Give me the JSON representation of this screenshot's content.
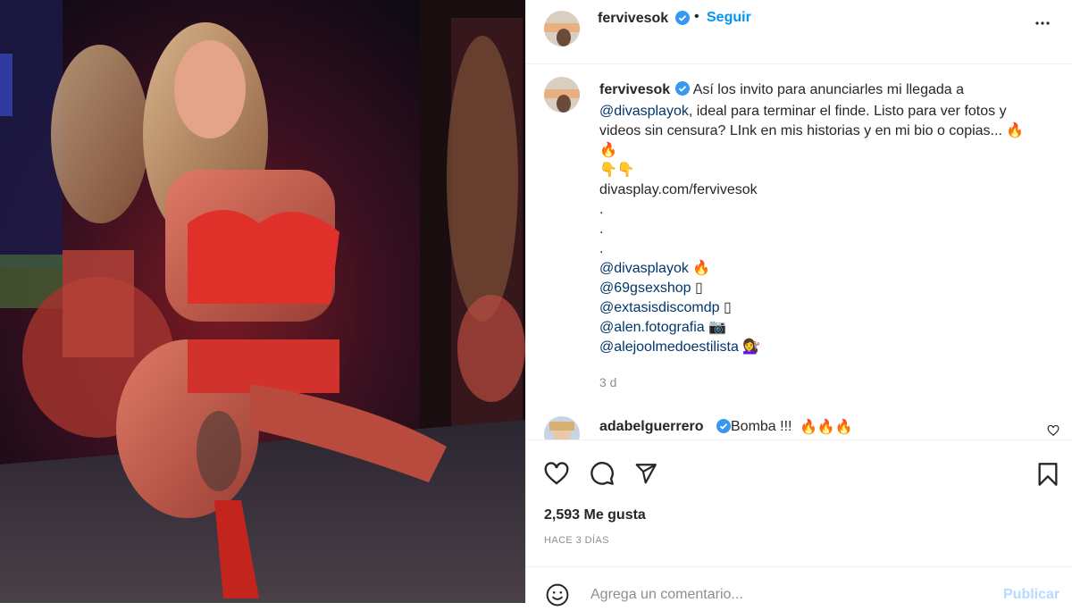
{
  "post": {
    "username": "fervivesok",
    "follow_label": "Seguir",
    "caption": {
      "line1": "Así los invito para anunciarles mi llegada a",
      "line2_mention": "@divasplayok",
      "line2_rest": ", ideal para terminar el finde. Listo para ver fotos y",
      "line3": "videos sin censura? LInk en mis historias y en mi bio o copias...",
      "emoji_fire": "🔥",
      "emoji_pointing": "👇👇",
      "link": "divasplay.com/fervivesok",
      "dot": ".",
      "mentions": [
        {
          "handle": "@divasplayok",
          "emoji": "🔥"
        },
        {
          "handle": "@69gsexshop",
          "emoji": "▯"
        },
        {
          "handle": "@extasisdiscomdp",
          "emoji": "▯"
        },
        {
          "handle": "@alen.fotografia",
          "emoji": "📷"
        },
        {
          "handle": "@alejoolmedoestilista",
          "emoji": "💇‍♀️"
        }
      ],
      "age": "3 d"
    },
    "comment": {
      "username": "adabelguerrero",
      "text": "Bomba !!!",
      "emojis": "🔥🔥🔥"
    },
    "likes_text": "2,593 Me gusta",
    "time_ago": "HACE 3 DÍAS",
    "add_comment_placeholder": "Agrega un comentario...",
    "publish_label": "Publicar"
  },
  "icons": {
    "verified": "verified-badge-icon",
    "more": "more-options-icon",
    "like": "heart-icon",
    "comment": "comment-icon",
    "share": "send-icon",
    "save": "bookmark-icon",
    "emoji": "emoji-smiley-icon",
    "comment_like": "small-heart-icon"
  },
  "colors": {
    "accent": "#0095f6",
    "verified": "#3897f0",
    "mention": "#00376b",
    "muted": "#8e8e8e",
    "publish_disabled": "#b3dbff"
  }
}
